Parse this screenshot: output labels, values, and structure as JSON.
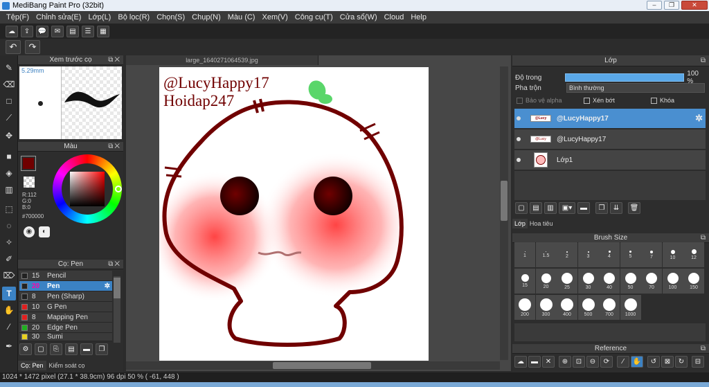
{
  "window": {
    "title": "MediBang Paint Pro (32bit)"
  },
  "menu": [
    "Tệp(F)",
    "Chỉnh sửa(E)",
    "Lớp(L)",
    "Bộ lọc(R)",
    "Chọn(S)",
    "Chụp(N)",
    "Màu (C)",
    "Xem(V)",
    "Công cụ(T)",
    "Cửa sổ(W)",
    "Cloud",
    "Help"
  ],
  "document": {
    "tab": "large_1640271064539.jpg"
  },
  "preview_panel": {
    "title": "Xem trước cọ",
    "size": "5.29mm"
  },
  "color_panel": {
    "title": "Màu",
    "r": "R:112",
    "g": "G:0",
    "b": "B:0",
    "hex": "#700000",
    "current": "#700000"
  },
  "brush_panel": {
    "title": "Cọ: Pen",
    "items": [
      {
        "size": "15",
        "name": "Pencil",
        "color": "#222222"
      },
      {
        "size": "20",
        "name": "Pen",
        "color": "#222222"
      },
      {
        "size": "8",
        "name": "Pen (Sharp)",
        "color": "#222222"
      },
      {
        "size": "10",
        "name": "G Pen",
        "color": "#e02020"
      },
      {
        "size": "8",
        "name": "Mapping Pen",
        "color": "#e02020"
      },
      {
        "size": "20",
        "name": "Edge Pen",
        "color": "#20b020"
      },
      {
        "size": "30",
        "name": "Sumi",
        "color": "#e8d020"
      }
    ],
    "tabs": [
      "Cọ: Pen",
      "Kiểm soát cọ"
    ]
  },
  "canvas_text": {
    "line1": "@LucyHappy17",
    "line2": "Hoidap247"
  },
  "layer_panel": {
    "title": "Lớp",
    "opacity_label": "Độ trong",
    "opacity_value": "100 %",
    "opacity": 1.0,
    "blend_label": "Pha trộn",
    "blend_value": "Bình thường",
    "protect_alpha": "Bảo vệ alpha",
    "clipping": "Xén bớt",
    "lock": "Khóa",
    "layers": [
      {
        "name": "@LucyHappy17",
        "selected": true
      },
      {
        "name": "@LucyHappy17",
        "selected": false
      },
      {
        "name": "Lớp1",
        "selected": false
      }
    ],
    "tabs": [
      "Lớp",
      "Hoa tiêu"
    ]
  },
  "brush_size_panel": {
    "title": "Brush Size",
    "sizes": [
      "1",
      "1.5",
      "2",
      "3",
      "4",
      "5",
      "7",
      "10",
      "12",
      "15",
      "20",
      "25",
      "30",
      "40",
      "50",
      "70",
      "100",
      "150",
      "200",
      "300",
      "400",
      "500",
      "700",
      "1000"
    ]
  },
  "reference_panel": {
    "title": "Reference"
  },
  "status": {
    "text": "1024 * 1472 pixel  (27.1 * 38.9cm)  96 dpi  50 %  ( -61, 448 )"
  },
  "colors": {
    "selection": "#3b82c4",
    "stroke": "#700000"
  }
}
